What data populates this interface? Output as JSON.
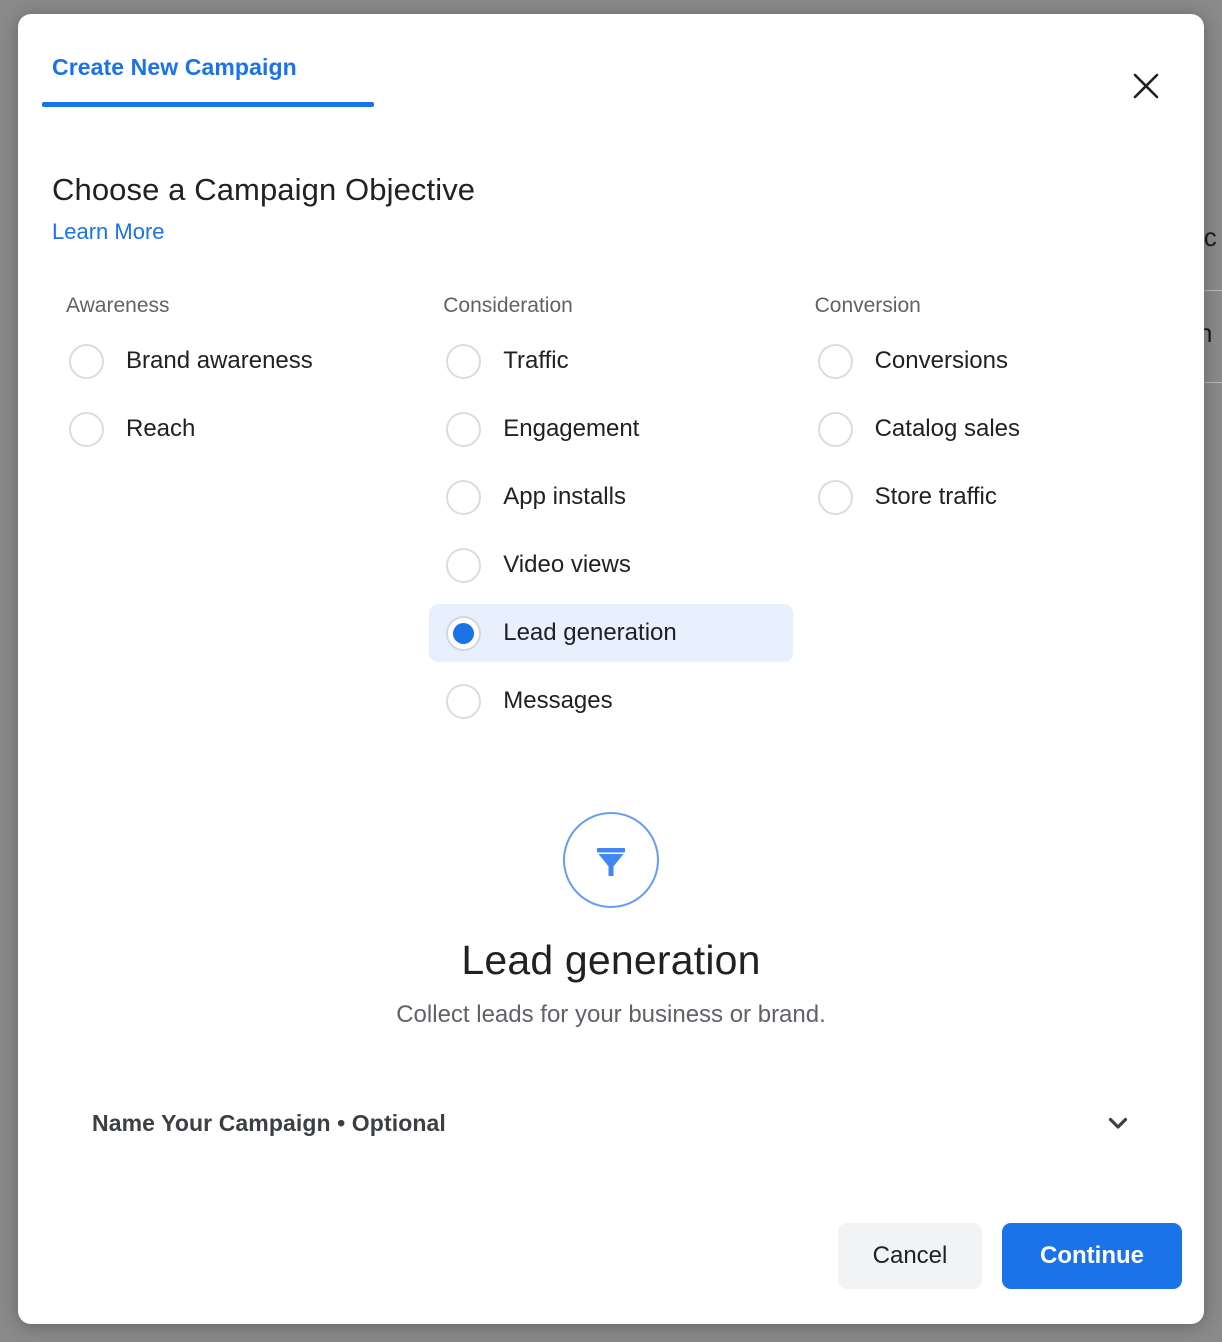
{
  "modal": {
    "tab_label": "Create New Campaign",
    "close_icon": "close-icon",
    "section_title": "Choose a Campaign Objective",
    "learn_more_label": "Learn More",
    "columns": [
      {
        "header": "Awareness",
        "options": [
          {
            "label": "Brand awareness",
            "selected": false
          },
          {
            "label": "Reach",
            "selected": false
          }
        ]
      },
      {
        "header": "Consideration",
        "options": [
          {
            "label": "Traffic",
            "selected": false
          },
          {
            "label": "Engagement",
            "selected": false
          },
          {
            "label": "App installs",
            "selected": false
          },
          {
            "label": "Video views",
            "selected": false
          },
          {
            "label": "Lead generation",
            "selected": true
          },
          {
            "label": "Messages",
            "selected": false
          }
        ]
      },
      {
        "header": "Conversion",
        "options": [
          {
            "label": "Conversions",
            "selected": false
          },
          {
            "label": "Catalog sales",
            "selected": false
          },
          {
            "label": "Store traffic",
            "selected": false
          }
        ]
      }
    ],
    "preview": {
      "icon": "funnel-icon",
      "title": "Lead generation",
      "description": "Collect leads for your business or brand."
    },
    "name_section": {
      "label": "Name Your Campaign • Optional",
      "chevron_icon": "chevron-down-icon",
      "expanded": false
    },
    "footer": {
      "cancel_label": "Cancel",
      "continue_label": "Continue"
    },
    "colors": {
      "accent": "#1a73e8",
      "selected_row_bg": "#e8f0fe",
      "icon_ring": "#669df6",
      "text_primary": "#202124",
      "text_secondary": "#5f6368",
      "cancel_bg": "#f1f3f4",
      "overlay": "#8a8a8a"
    }
  },
  "background": {
    "fragment_1": "ic",
    "fragment_2": "n"
  }
}
